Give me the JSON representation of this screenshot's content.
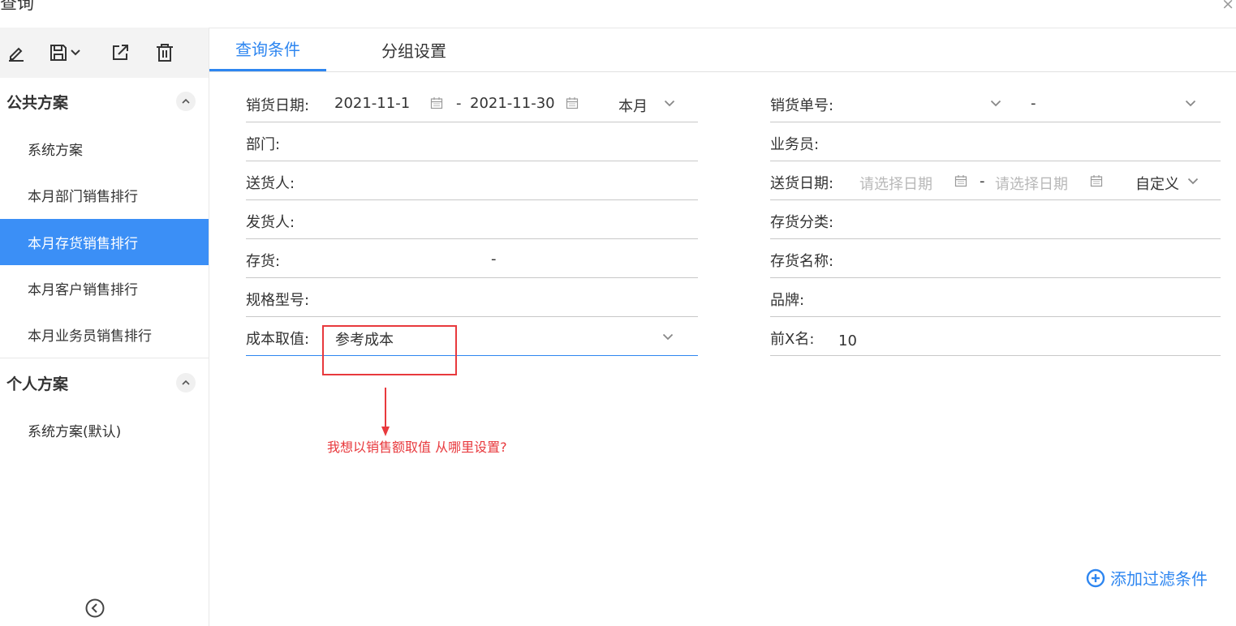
{
  "window": {
    "title": "查询",
    "close_label": "×"
  },
  "sidebar": {
    "public_group": {
      "title": "公共方案"
    },
    "public_items": [
      {
        "label": "系统方案"
      },
      {
        "label": "本月部门销售排行"
      },
      {
        "label": "本月存货销售排行",
        "active": true
      },
      {
        "label": "本月客户销售排行"
      },
      {
        "label": "本月业务员销售排行"
      }
    ],
    "personal_group": {
      "title": "个人方案"
    },
    "personal_items": [
      {
        "label": "系统方案(默认)"
      }
    ]
  },
  "tabs": [
    {
      "label": "查询条件",
      "active": true
    },
    {
      "label": "分组设置"
    }
  ],
  "form": {
    "sales_date": {
      "label": "销货日期:",
      "from": "2021-11-1",
      "to": "2021-11-30",
      "preset": "本月"
    },
    "dept": {
      "label": "部门:"
    },
    "deliverer": {
      "label": "送货人:"
    },
    "shipper": {
      "label": "发货人:"
    },
    "inventory": {
      "label": "存货:",
      "sep": "-"
    },
    "spec": {
      "label": "规格型号:"
    },
    "cost": {
      "label": "成本取值:",
      "value": "参考成本"
    },
    "sales_no": {
      "label": "销货单号:",
      "sep": "-"
    },
    "salesman": {
      "label": "业务员:"
    },
    "delivery_date": {
      "label": "送货日期:",
      "from_placeholder": "请选择日期",
      "to_placeholder": "请选择日期",
      "preset": "自定义"
    },
    "category": {
      "label": "存货分类:"
    },
    "inv_name": {
      "label": "存货名称:"
    },
    "brand": {
      "label": "品牌:"
    },
    "top_x": {
      "label": "前X名:",
      "value": "10"
    },
    "date_sep": "-"
  },
  "annotation": {
    "text": "我想以销售额取值 从哪里设置?"
  },
  "add_filter": {
    "label": "添加过滤条件"
  },
  "colors": {
    "accent": "#2e86f0",
    "active_item": "#3b8ff6",
    "annotation": "#e8393d"
  }
}
